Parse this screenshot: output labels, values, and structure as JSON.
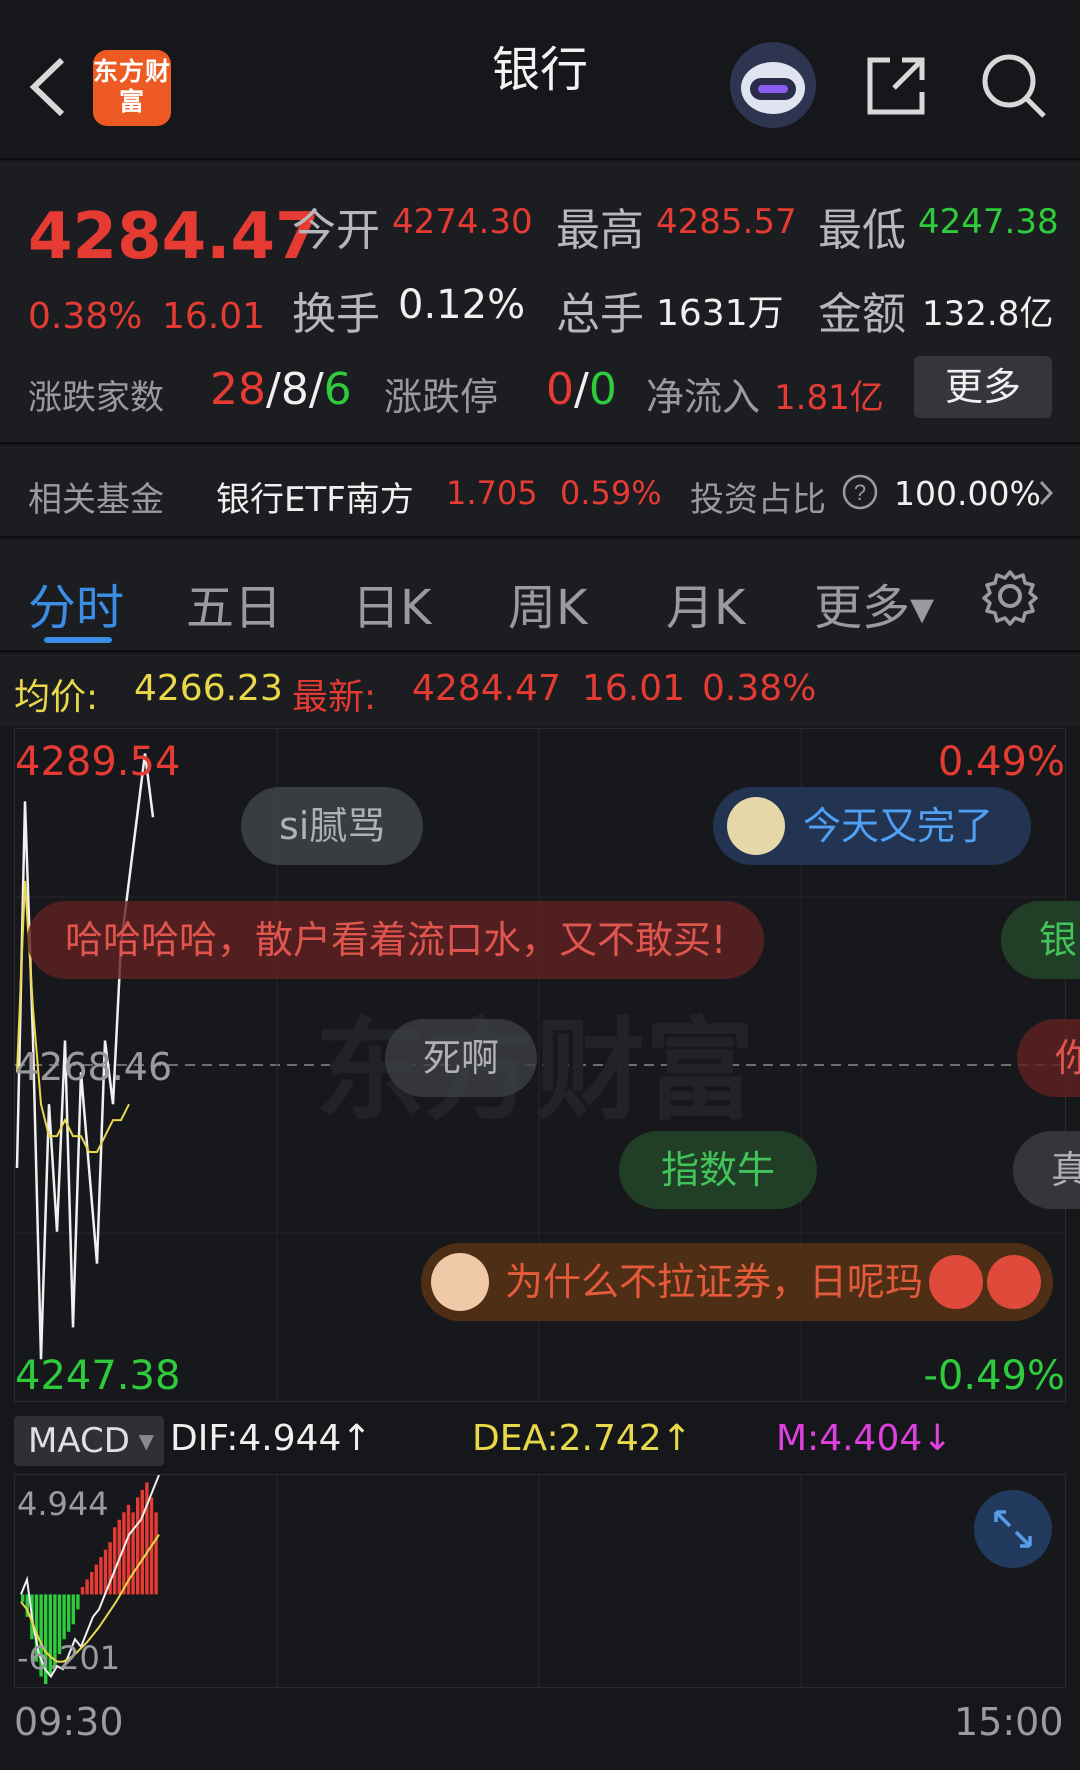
{
  "header": {
    "title": "银行",
    "logo_text": "东方财富",
    "back_icon": "chevron-left-icon",
    "robot_icon": "robot-avatar-icon",
    "share_icon": "share-icon",
    "search_icon": "search-icon"
  },
  "quote": {
    "price": "4284.47",
    "change_pct": "0.38%",
    "change": "16.01",
    "open_label": "今开",
    "open": "4274.30",
    "high_label": "最高",
    "high": "4285.57",
    "low_label": "最低",
    "low": "4247.38",
    "turnover_label": "换手",
    "turnover": "0.12%",
    "volume_label": "总手",
    "volume": "1631万",
    "amount_label": "金额",
    "amount": "132.8亿",
    "breadth_label": "涨跌家数",
    "breadth_up": "28",
    "breadth_flat": "8",
    "breadth_down": "6",
    "limit_label": "涨跌停",
    "limit_up": "0",
    "limit_down": "0",
    "inflow_label": "净流入",
    "inflow": "1.81亿",
    "more": "更多",
    "sep": "/"
  },
  "fund": {
    "label": "相关基金",
    "name": "银行ETF南方",
    "price": "1.705",
    "pct": "0.59%",
    "ratio_label": "投资占比",
    "ratio": "100.00%"
  },
  "tabs": [
    {
      "label": "分时"
    },
    {
      "label": "五日"
    },
    {
      "label": "日K"
    },
    {
      "label": "周K"
    },
    {
      "label": "月K"
    },
    {
      "label": "更多▾"
    }
  ],
  "avg_row": {
    "avg_label": "均价:",
    "avg": "4266.23",
    "latest_label": "最新:",
    "latest": "4284.47",
    "change": "16.01",
    "pct": "0.38%"
  },
  "chart_data": {
    "type": "line",
    "y_top": "4289.54",
    "y_mid": "4268.46",
    "y_bottom": "4247.38",
    "pct_top": "0.49%",
    "pct_bottom": "-0.49%",
    "x_start": "09:30",
    "x_end": "15:00",
    "ylim": [
      4247.38,
      4289.54
    ],
    "series": [
      {
        "values": [
          4262,
          4285,
          4270,
          4250,
          4266,
          4258,
          4270,
          4252,
          4268,
          4262,
          4256,
          4270,
          4266,
          4276,
          4280,
          4284,
          4288,
          4284
        ]
      },
      {
        "values": [
          4268,
          4280,
          4272,
          4266,
          4264,
          4264,
          4265,
          4264,
          4264,
          4263,
          4263,
          4264,
          4265,
          4265,
          4266
        ]
      }
    ]
  },
  "danmu": [
    {
      "text": "si腻骂"
    },
    {
      "text": "今天又完了"
    },
    {
      "text": "哈哈哈哈，散户看着流口水，又不敢买!"
    },
    {
      "text": "银"
    },
    {
      "text": "死啊"
    },
    {
      "text": "你"
    },
    {
      "text": "指数牛"
    },
    {
      "text": "真"
    },
    {
      "text": "为什么不拉证券，日呢玛"
    }
  ],
  "watermark": "东方财富",
  "macd": {
    "select": "MACD",
    "dif": "DIF:4.944↑",
    "dea": "DEA:2.742↑",
    "m": "M:4.404↓",
    "top": "4.944",
    "bottom": "-6.201",
    "colors": {
      "dif": "#f0f0f0",
      "dea": "#e8d84a",
      "m": "#e040e0"
    }
  },
  "colors": {
    "up": "#e53b33",
    "down": "#2ecc3d",
    "accent": "#3a8ee6",
    "avg": "#e8d84a"
  }
}
